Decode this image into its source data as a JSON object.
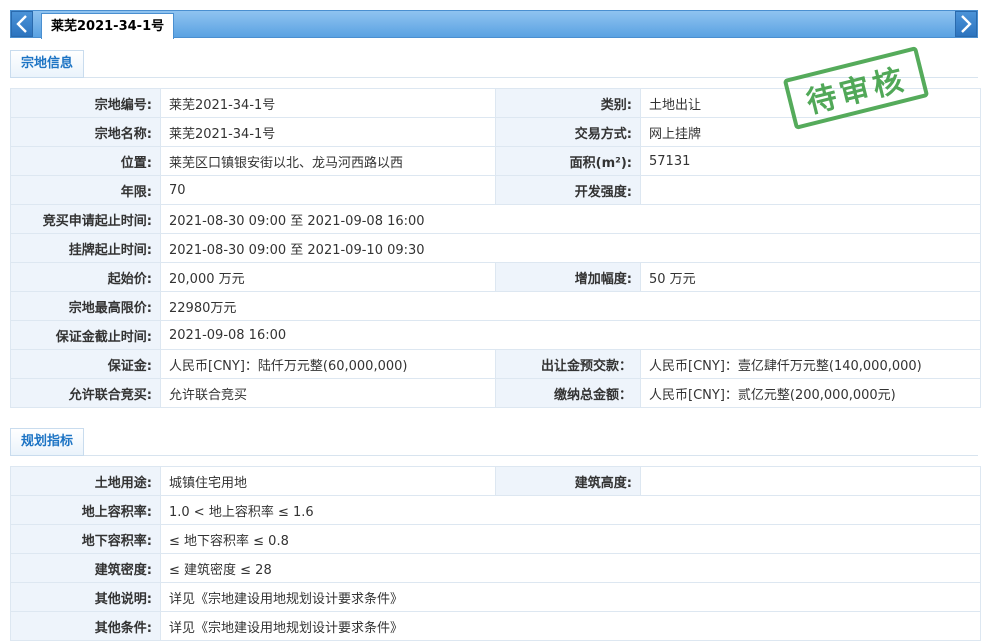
{
  "tab": {
    "title": "莱芜2021-34-1号"
  },
  "icons": {
    "prev": "chevron-left-icon",
    "next": "chevron-right-icon"
  },
  "stamp": {
    "text": "待审核",
    "color": "#43a24a"
  },
  "section1": {
    "title": "宗地信息",
    "rows": [
      [
        {
          "label": "宗地编号:",
          "value": "莱芜2021-34-1号"
        },
        {
          "label": "类别:",
          "value": "土地出让"
        }
      ],
      [
        {
          "label": "宗地名称:",
          "value": "莱芜2021-34-1号"
        },
        {
          "label": "交易方式:",
          "value": "网上挂牌"
        }
      ],
      [
        {
          "label": "位置:",
          "value": "莱芜区口镇银安街以北、龙马河西路以西"
        },
        {
          "label": "面积(m²):",
          "value": "57131"
        }
      ],
      [
        {
          "label": "年限:",
          "value": "70"
        },
        {
          "label": "开发强度:",
          "value": ""
        }
      ],
      [
        {
          "label": "竞买申请起止时间:",
          "value": "2021-08-30 09:00 至 2021-09-08 16:00"
        }
      ],
      [
        {
          "label": "挂牌起止时间:",
          "value": "2021-08-30 09:00 至 2021-09-10 09:30"
        }
      ],
      [
        {
          "label": "起始价:",
          "value": "20,000 万元"
        },
        {
          "label": "增加幅度:",
          "value": "50 万元"
        }
      ],
      [
        {
          "label": "宗地最高限价:",
          "value": "22980万元"
        }
      ],
      [
        {
          "label": "保证金截止时间:",
          "value": "2021-09-08 16:00"
        }
      ],
      [
        {
          "label": "保证金:",
          "value": "人民币[CNY]：陆仟万元整(60,000,000)"
        },
        {
          "label": "出让金预交款：",
          "value": "人民币[CNY]：壹亿肆仟万元整(140,000,000)"
        }
      ],
      [
        {
          "label": "允许联合竞买:",
          "value": "允许联合竞买"
        },
        {
          "label": "缴纳总金额：",
          "value": "人民币[CNY]：贰亿元整(200,000,000元)"
        }
      ]
    ]
  },
  "section2": {
    "title": "规划指标",
    "rows": [
      [
        {
          "label": "土地用途:",
          "value": "城镇住宅用地"
        },
        {
          "label": "建筑高度:",
          "value": ""
        }
      ],
      [
        {
          "label": "地上容积率:",
          "value": "1.0 < 地上容积率 ≤ 1.6"
        }
      ],
      [
        {
          "label": "地下容积率:",
          "value": "≤ 地下容积率 ≤ 0.8"
        }
      ],
      [
        {
          "label": "建筑密度:",
          "value": "≤ 建筑密度 ≤ 28"
        }
      ],
      [
        {
          "label": "其他说明:",
          "value": "详见《宗地建设用地规划设计要求条件》"
        }
      ],
      [
        {
          "label": "其他条件:",
          "value": "详见《宗地建设用地规划设计要求条件》"
        }
      ]
    ]
  }
}
